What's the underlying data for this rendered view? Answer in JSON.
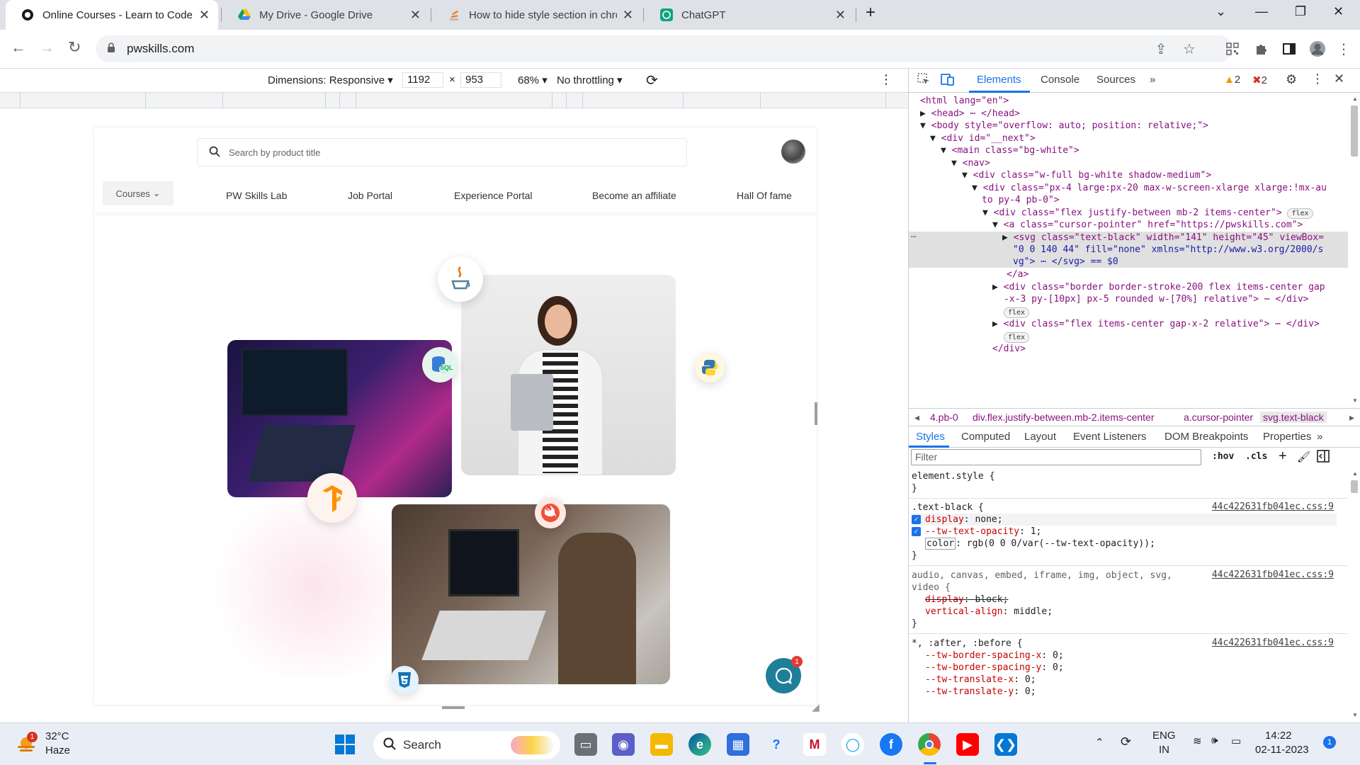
{
  "browser": {
    "tabs": [
      {
        "title": "Online Courses - Learn to Code",
        "favicon": "pwskills-favicon",
        "active": true
      },
      {
        "title": "My Drive - Google Drive",
        "favicon": "google-drive-icon",
        "active": false
      },
      {
        "title": "How to hide style section in chro",
        "favicon": "stackoverflow-icon",
        "active": false
      },
      {
        "title": "ChatGPT",
        "favicon": "chatgpt-icon",
        "active": false
      }
    ],
    "url": "pwskills.com"
  },
  "device_toolbar": {
    "dimensions_label": "Dimensions: Responsive",
    "width": "1192",
    "height": "953",
    "times": "×",
    "zoom": "68%",
    "throttling": "No throttling"
  },
  "site": {
    "search_placeholder": "Search by product title",
    "nav": {
      "courses": "Courses",
      "links": [
        "PW Skills Lab",
        "Job Portal",
        "Experience Portal",
        "Become an affiliate",
        "Hall Of fame"
      ]
    },
    "sql_badge": "SQL",
    "chat_count": "1"
  },
  "devtools": {
    "tabs": [
      "Elements",
      "Console",
      "Sources"
    ],
    "more": "»",
    "warnings": "2",
    "errors": "2",
    "dom_lines": [
      {
        "indent": 1,
        "arrow": "",
        "html": "<span class='tg'>&lt;html</span> <span class='an'>lang</span>=<span class='av'>\"en\"</span><span class='tg'>&gt;</span>"
      },
      {
        "indent": 1,
        "arrow": "▶",
        "html": "<span class='tg'>&lt;head&gt;</span> <span class='pill'>⋯</span> <span class='tg'>&lt;/head&gt;</span>"
      },
      {
        "indent": 1,
        "arrow": "▼",
        "html": "<span class='tg'>&lt;body</span> <span class='an'>style</span>=<span class='av'>\"overflow: auto; position: relative;\"</span><span class='tg'>&gt;</span>"
      }
    ],
    "dom_text": [
      "<html lang=\"en\">",
      "<head> ⋯ </head>",
      "<body style=\"overflow: auto; position: relative;\">",
      "<div id=\"__next\">",
      "<main class=\"bg-white\">",
      "<nav>",
      "<div class=\"w-full bg-white shadow-medium\">",
      "<div class=\"px-4 large:px-20 max-w-screen-xlarge xlarge:!mx-au",
      "to py-4 pb-0\">",
      "<div class=\"flex justify-between mb-2 items-center\">",
      "<a class=\"cursor-pointer\" href=\"https://pwskills.com\">",
      "<svg class=\"text-black\" width=\"141\" height=\"45\" viewBox=",
      "\"0 0 140 44\" fill=\"none\" xmlns=\"http://www.w3.org/2000/s",
      "vg\"> ⋯ </svg> == $0",
      "</a>",
      "<div class=\"border border-stroke-200 flex items-center gap",
      "-x-3 py-[10px] px-5 rounded w-[70%] relative\"> ⋯ </div>",
      "<div class=\"flex items-center gap-x-2 relative\"> ⋯ </div>",
      "</div>"
    ],
    "flex_pill": "flex",
    "breadcrumbs": [
      "4.pb-0",
      "div.flex.justify-between.mb-2.items-center",
      "a.cursor-pointer",
      "svg.text-black"
    ],
    "subtabs": [
      "Styles",
      "Computed",
      "Layout",
      "Event Listeners",
      "DOM Breakpoints",
      "Properties"
    ],
    "filter_placeholder": "Filter",
    "hov": ":hov",
    "cls": ".cls",
    "styles": {
      "element_style": "element.style {",
      "close": "}",
      "rule1_selector": ".text-black {",
      "rule1_source": "44c422631fb041ec.css:9",
      "rule1_props": [
        {
          "name": "display",
          "value": "none;"
        },
        {
          "name": "--tw-text-opacity",
          "value": "1;"
        },
        {
          "name": "color",
          "value": "rgb(0 0 0/var(--tw-text-opacity));"
        }
      ],
      "rule2_selector": "audio, canvas, embed, iframe, img, object, svg,",
      "rule2_selector_b": "video {",
      "rule2_source": "44c422631fb041ec.css:9",
      "rule2_props": [
        {
          "name": "display",
          "value": "block;"
        },
        {
          "name": "vertical-align",
          "value": "middle;"
        }
      ],
      "rule3_selector": "*, :after, :before {",
      "rule3_source": "44c422631fb041ec.css:9",
      "rule3_props": [
        {
          "name": "--tw-border-spacing-x",
          "value": "0;"
        },
        {
          "name": "--tw-border-spacing-y",
          "value": "0;"
        },
        {
          "name": "--tw-translate-x",
          "value": "0;"
        },
        {
          "name": "--tw-translate-y",
          "value": "0;"
        }
      ]
    }
  },
  "taskbar": {
    "weather_temp": "32°C",
    "weather_desc": "Haze",
    "weather_badge": "1",
    "search_label": "Search",
    "lang": "ENG",
    "region": "IN",
    "time": "14:22",
    "date": "02-11-2023",
    "notif_count": "1"
  },
  "colors": {
    "accent": "#1a73e8",
    "chat_button": "#1f7f99",
    "error_red": "#d93025",
    "warning_orange": "#f29900"
  }
}
